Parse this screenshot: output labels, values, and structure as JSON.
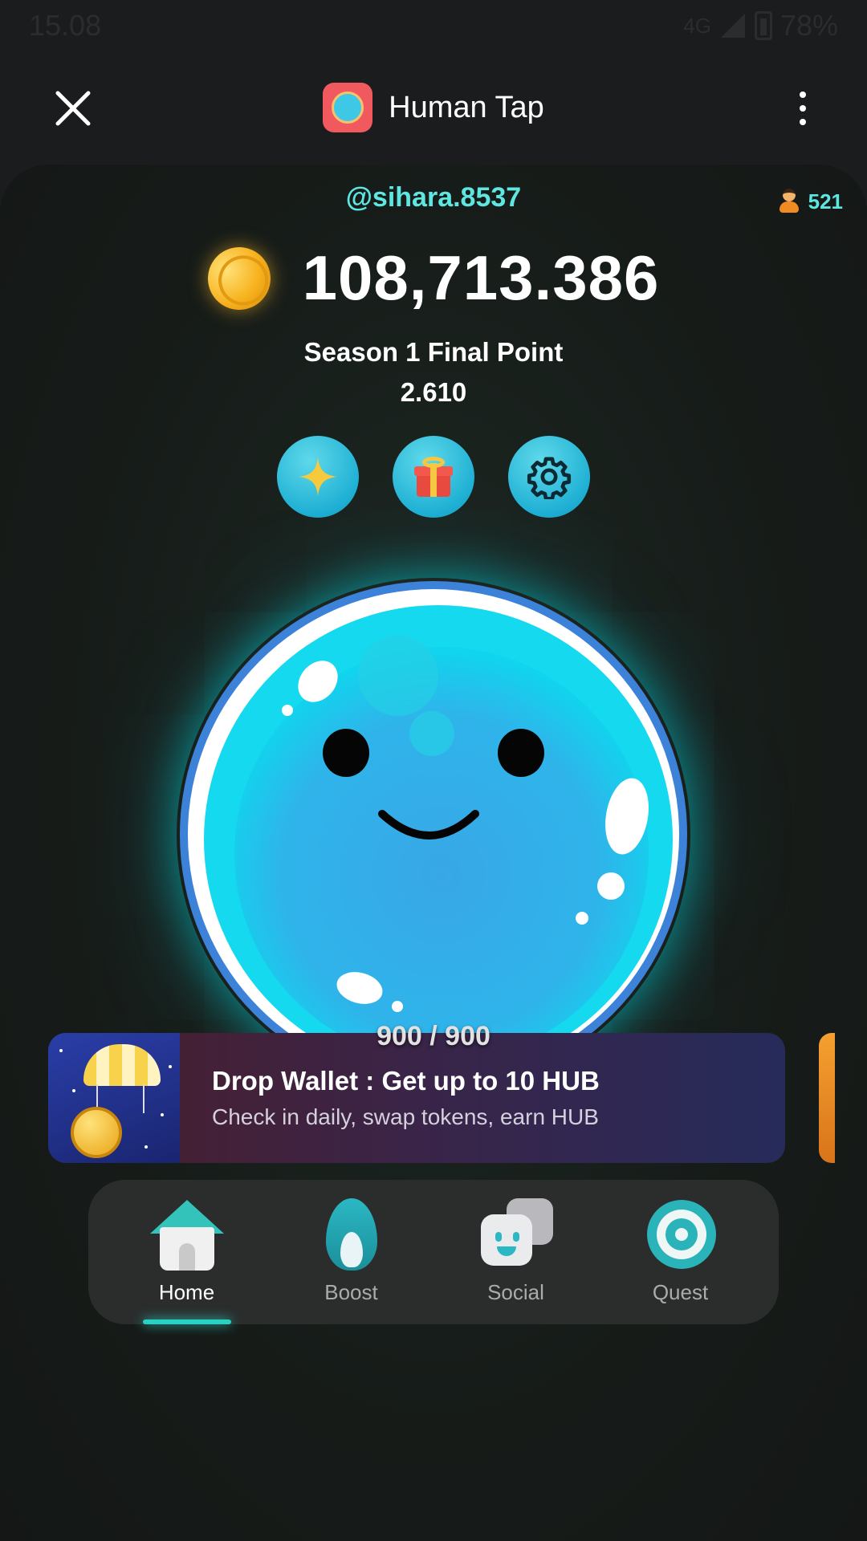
{
  "status_bar": {
    "time": "15.08",
    "network": "4G",
    "battery": "78%"
  },
  "app": {
    "title": "Human Tap"
  },
  "user": {
    "username": "@sihara.8537",
    "referrals": "521"
  },
  "balance": {
    "value": "108,713.386"
  },
  "season": {
    "label": "Season 1 Final Point",
    "value": "2.610"
  },
  "actions": [
    {
      "icon": "sparkle-icon"
    },
    {
      "icon": "gift-icon"
    },
    {
      "icon": "gear-icon"
    }
  ],
  "energy": {
    "text": "900 / 900",
    "current": 900,
    "max": 900
  },
  "promo": {
    "title": "Drop Wallet : Get up to 10 HUB",
    "subtitle": "Check in daily, swap tokens, earn HUB"
  },
  "nav": {
    "items": [
      {
        "label": "Home",
        "active": true
      },
      {
        "label": "Boost",
        "active": false
      },
      {
        "label": "Social",
        "active": false
      },
      {
        "label": "Quest",
        "active": false
      }
    ]
  },
  "colors": {
    "accent": "#5ee6e0",
    "bubble": "#1ec8e6",
    "background": "#1b1c1e",
    "nav_active_glow": "#2ad1c2"
  }
}
